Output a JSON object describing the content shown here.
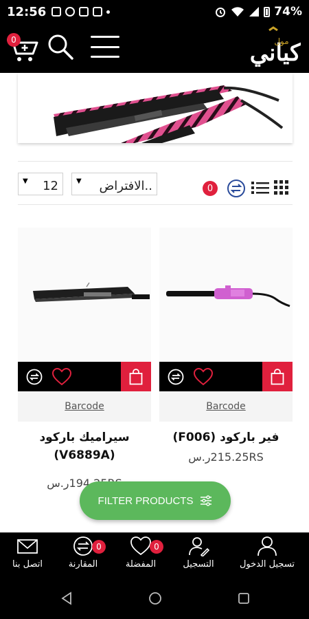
{
  "status_bar": {
    "time": "12:56",
    "battery": "74%"
  },
  "header": {
    "cart_count": "0",
    "logo_text": "كياني",
    "logo_sub": "مول"
  },
  "toolbar": {
    "per_page": "12",
    "sort": "الافتراض..",
    "compare_count": "0"
  },
  "products": [
    {
      "name": "فير باركود (F006)",
      "price": "215.25RSر.س",
      "barcode": "Barcode"
    },
    {
      "name": "سيراميك باركود (V6889A)",
      "price": "194.25RSر.س",
      "barcode": "Barcode"
    }
  ],
  "filter_button": {
    "label": "FILTER PRODUCTS"
  },
  "bottom_nav": {
    "items": [
      {
        "label": "اتصل بنا",
        "icon": "mail-icon"
      },
      {
        "label": "المقارنة",
        "icon": "compare-icon",
        "badge": "0"
      },
      {
        "label": "المفضلة",
        "icon": "heart-icon",
        "badge": "0"
      },
      {
        "label": "التسجيل",
        "icon": "register-icon"
      },
      {
        "label": "تسجيل الدخول",
        "icon": "user-icon"
      }
    ]
  },
  "colors": {
    "accent": "#e0203d",
    "filter": "#5cb85c",
    "header": "#000000"
  }
}
